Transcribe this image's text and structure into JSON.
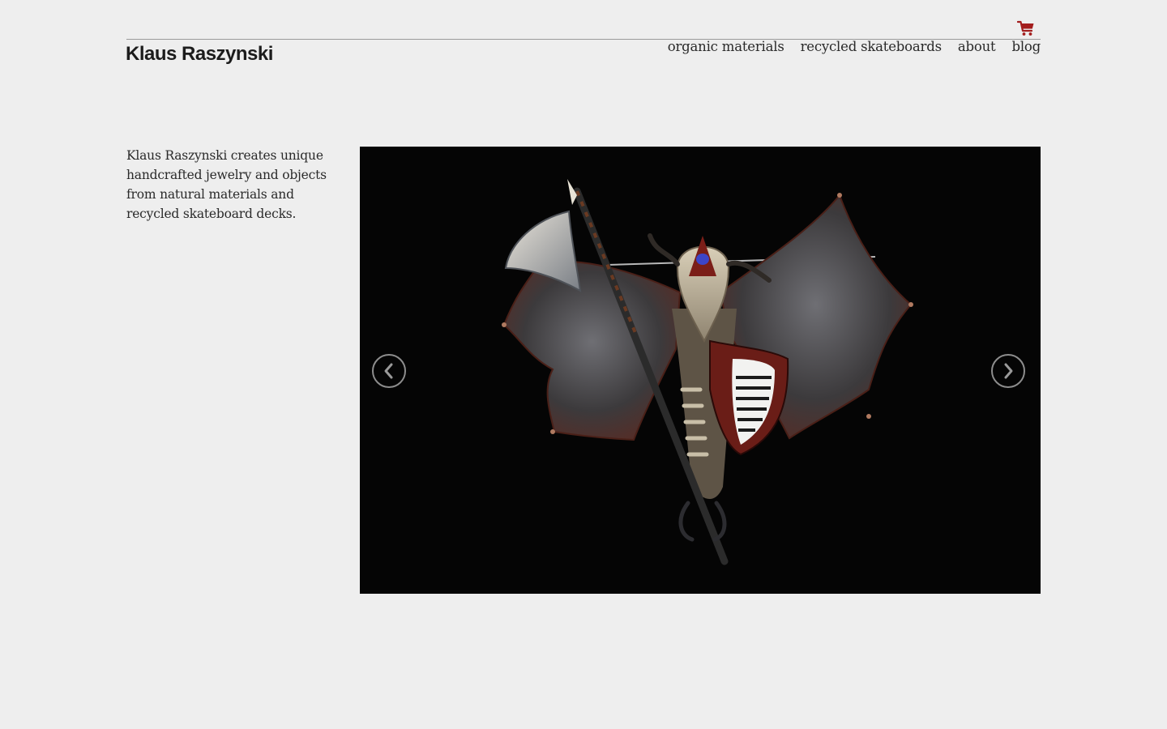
{
  "header": {
    "logo": "Klaus Raszynski",
    "cart_icon": "shopping-cart-icon",
    "accent_color": "#a31d1d",
    "nav": [
      {
        "label": "organic materials"
      },
      {
        "label": "recycled skateboards"
      },
      {
        "label": "about"
      },
      {
        "label": "blog"
      }
    ]
  },
  "main": {
    "intro": "Klaus Raszynski creates unique handcrafted jewelry and objects from natural materials and recycled skateboard decks.",
    "slideshow": {
      "image": "bat-winged-skull-brooch-with-axe-and-shield",
      "prev_icon": "chevron-left-icon",
      "next_icon": "chevron-right-icon"
    }
  }
}
